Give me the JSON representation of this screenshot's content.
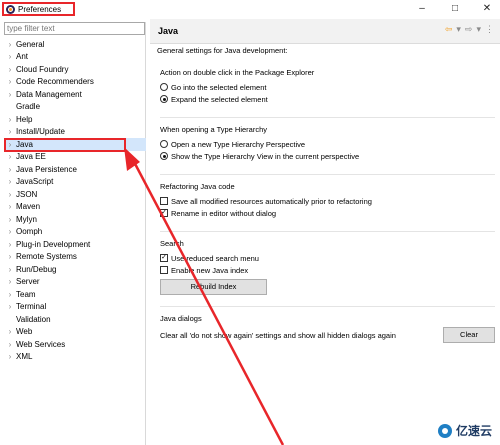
{
  "window": {
    "title": "Preferences",
    "controls": {
      "minimize": "–",
      "maximize": "□",
      "close": "✕"
    }
  },
  "filter": {
    "placeholder": "type filter text"
  },
  "tree": [
    {
      "label": "General",
      "expandable": true
    },
    {
      "label": "Ant",
      "expandable": true
    },
    {
      "label": "Cloud Foundry",
      "expandable": true
    },
    {
      "label": "Code Recommenders",
      "expandable": true
    },
    {
      "label": "Data Management",
      "expandable": true
    },
    {
      "label": "Gradle",
      "expandable": false
    },
    {
      "label": "Help",
      "expandable": true
    },
    {
      "label": "Install/Update",
      "expandable": true
    },
    {
      "label": "Java",
      "expandable": true,
      "selected": true
    },
    {
      "label": "Java EE",
      "expandable": true
    },
    {
      "label": "Java Persistence",
      "expandable": true
    },
    {
      "label": "JavaScript",
      "expandable": true
    },
    {
      "label": "JSON",
      "expandable": true
    },
    {
      "label": "Maven",
      "expandable": true
    },
    {
      "label": "Mylyn",
      "expandable": true
    },
    {
      "label": "Oomph",
      "expandable": true
    },
    {
      "label": "Plug-in Development",
      "expandable": true
    },
    {
      "label": "Remote Systems",
      "expandable": true
    },
    {
      "label": "Run/Debug",
      "expandable": true
    },
    {
      "label": "Server",
      "expandable": true
    },
    {
      "label": "Team",
      "expandable": true
    },
    {
      "label": "Terminal",
      "expandable": true
    },
    {
      "label": "Validation",
      "expandable": false
    },
    {
      "label": "Web",
      "expandable": true
    },
    {
      "label": "Web Services",
      "expandable": true
    },
    {
      "label": "XML",
      "expandable": true
    }
  ],
  "page": {
    "title": "Java",
    "description": "General settings for Java development:",
    "package_explorer": {
      "label": "Action on double click in the Package Explorer",
      "options": [
        "Go into the selected element",
        "Expand the selected element"
      ],
      "selected_index": 1
    },
    "type_hierarchy": {
      "label": "When opening a Type Hierarchy",
      "options": [
        "Open a new Type Hierarchy Perspective",
        "Show the Type Hierarchy View in the current perspective"
      ],
      "selected_index": 1
    },
    "refactoring": {
      "label": "Refactoring Java code",
      "save_all": {
        "label": "Save all modified resources automatically prior to refactoring",
        "checked": false
      },
      "rename_in_editor": {
        "label": "Rename in editor without dialog",
        "checked": true
      }
    },
    "search": {
      "label": "Search",
      "reduced_menu": {
        "label": "Use reduced search menu",
        "checked": true
      },
      "new_index": {
        "label": "Enable new Java index",
        "checked": false
      },
      "rebuild_button": "Rebuild Index"
    },
    "dialogs": {
      "label": "Java dialogs",
      "clear_text": "Clear all 'do not show again' settings and show all hidden dialogs again",
      "clear_button": "Clear"
    }
  },
  "watermark": {
    "text": "亿速云"
  },
  "colors": {
    "annotation": "#e8262a",
    "selection": "#d3e6fb",
    "header_bg": "#f2f2f2"
  }
}
